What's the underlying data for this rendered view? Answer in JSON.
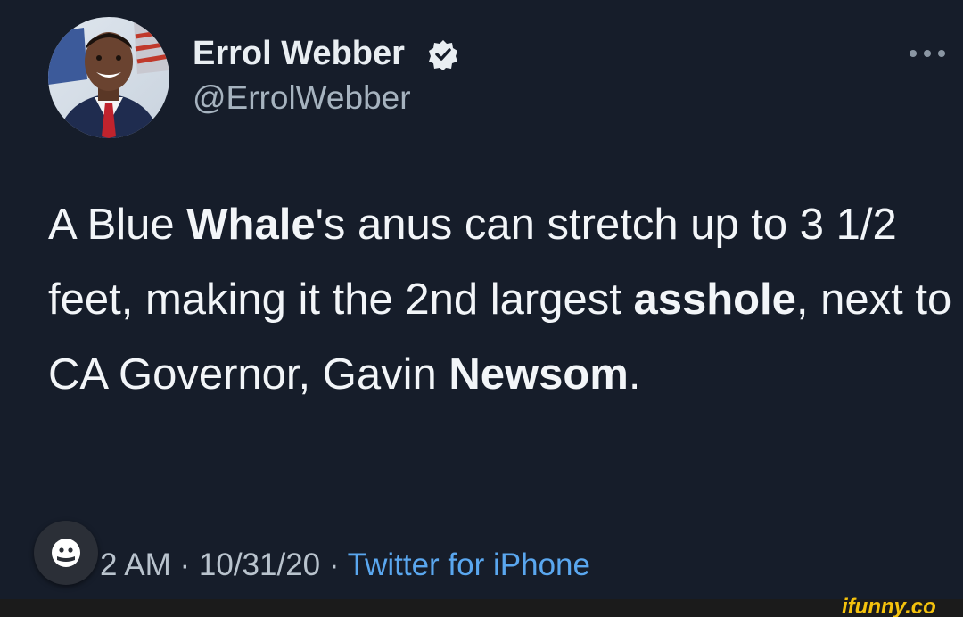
{
  "author": {
    "display_name": "Errol Webber",
    "handle": "@ErrolWebber",
    "verified": true
  },
  "tweet": {
    "text_parts": {
      "p1": "A Blue ",
      "b1": "Whale",
      "p2": "'s anus can stretch up to 3 1/2 feet, making it the 2nd largest ",
      "b2": "asshole",
      "p3": ", next to CA Governor, Gavin ",
      "b3": "Newsom",
      "p4": "."
    },
    "time": "2 AM",
    "separator": "·",
    "date": "10/31/20",
    "source": "Twitter for iPhone"
  },
  "watermark": "ifunny.co",
  "colors": {
    "background": "#161d2a",
    "link": "#5aa7ef",
    "watermark": "#f4c20d"
  },
  "icons": {
    "verified": "verified-badge-icon",
    "more": "more-options-icon",
    "overlay": "user-icon"
  }
}
